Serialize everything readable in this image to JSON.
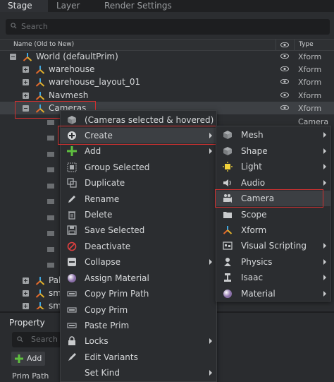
{
  "tabs": [
    "Stage",
    "Layer",
    "Render Settings"
  ],
  "search_placeholder": "Search",
  "columns": {
    "name": "Name (Old to New)",
    "type": "Type"
  },
  "tree": [
    {
      "label": "World (defaultPrim)",
      "type": "Xform"
    },
    {
      "label": "warehouse",
      "type": "Xform"
    },
    {
      "label": "warehouse_layout_01",
      "type": "Xform"
    },
    {
      "label": "Navmesh",
      "type": "Xform"
    },
    {
      "label": "Cameras",
      "type": "Xform"
    },
    {
      "label": "",
      "type": "Camera"
    }
  ],
  "bottom_rows": [
    {
      "label": "Pal"
    },
    {
      "label": "sm"
    },
    {
      "label": "sm"
    }
  ],
  "context_menu": [
    {
      "label": "(Cameras selected & hovered)",
      "icon": "cube-icon",
      "submenu": false
    },
    {
      "label": "Create",
      "icon": "plus-circle-icon",
      "submenu": true
    },
    {
      "label": "Add",
      "icon": "green-plus-icon",
      "submenu": true
    },
    {
      "label": "Group Selected",
      "icon": "group-icon",
      "submenu": false
    },
    {
      "label": "Duplicate",
      "icon": "duplicate-icon",
      "submenu": false
    },
    {
      "label": "Rename",
      "icon": "pencil-icon",
      "submenu": false
    },
    {
      "label": "Delete",
      "icon": "trash-icon",
      "submenu": false
    },
    {
      "label": "Save Selected",
      "icon": "save-icon",
      "submenu": false
    },
    {
      "label": "Deactivate",
      "icon": "deactivate-icon",
      "submenu": false
    },
    {
      "label": "Collapse",
      "icon": "collapse-icon",
      "submenu": true
    },
    {
      "label": "Assign Material",
      "icon": "material-sphere-icon",
      "submenu": false
    },
    {
      "label": "Copy Prim Path",
      "icon": "copy-path-icon",
      "submenu": false
    },
    {
      "label": "Copy Prim",
      "icon": "copy-prim-icon",
      "submenu": false
    },
    {
      "label": "Paste Prim",
      "icon": "paste-prim-icon",
      "submenu": false
    },
    {
      "label": "Locks",
      "icon": "lock-icon",
      "submenu": true
    },
    {
      "label": "Edit Variants",
      "icon": "brush-icon",
      "submenu": false
    },
    {
      "label": "Set Kind",
      "icon": "",
      "submenu": true
    }
  ],
  "create_submenu": [
    {
      "label": "Mesh",
      "icon": "mesh-cube-icon",
      "submenu": true
    },
    {
      "label": "Shape",
      "icon": "shape-cube-icon",
      "submenu": true
    },
    {
      "label": "Light",
      "icon": "light-icon",
      "submenu": true
    },
    {
      "label": "Audio",
      "icon": "audio-icon",
      "submenu": true
    },
    {
      "label": "Camera",
      "icon": "camera-icon",
      "submenu": false
    },
    {
      "label": "Scope",
      "icon": "folder-icon",
      "submenu": false
    },
    {
      "label": "Xform",
      "icon": "xform-axes-icon",
      "submenu": false
    },
    {
      "label": "Visual Scripting",
      "icon": "visual-scripting-icon",
      "submenu": true
    },
    {
      "label": "Physics",
      "icon": "physics-icon",
      "submenu": true
    },
    {
      "label": "Isaac",
      "icon": "isaac-icon",
      "submenu": true
    },
    {
      "label": "Material",
      "icon": "material-sphere-icon",
      "submenu": true
    }
  ],
  "property": {
    "title": "Property",
    "search_placeholder": "Search",
    "add_label": "Add",
    "prim_path_label": "Prim Path"
  },
  "colors": {
    "highlight_box": "#d03030",
    "selected_row": "#3d4044",
    "background": "#2b2d30"
  }
}
